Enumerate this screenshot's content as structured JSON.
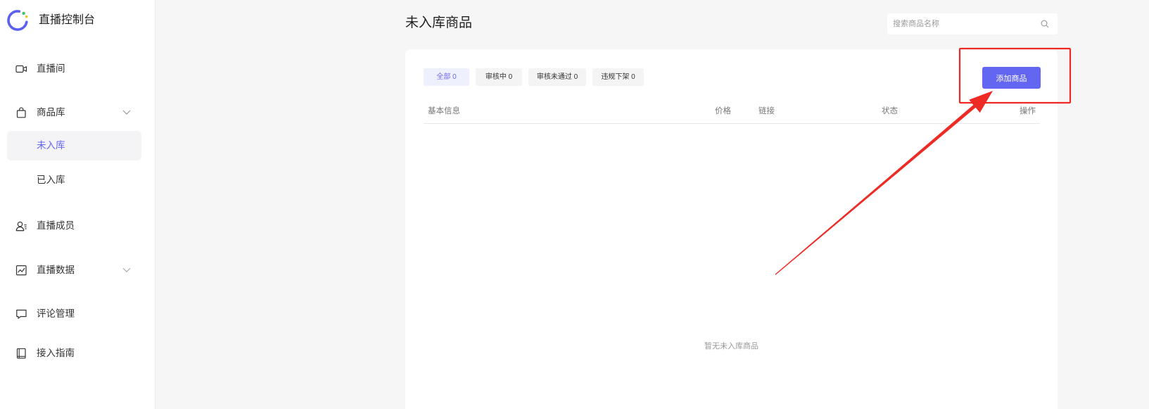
{
  "app": {
    "title": "直播控制台",
    "logo_icon": "app-logo-icon"
  },
  "sidebar": {
    "items": [
      {
        "label": "直播间",
        "icon": "video-camera-icon"
      },
      {
        "label": "商品库",
        "icon": "shopping-bag-icon",
        "expanded": true,
        "children": [
          {
            "label": "未入库",
            "active": true
          },
          {
            "label": "已入库",
            "active": false
          }
        ]
      },
      {
        "label": "直播成员",
        "icon": "user-group-icon"
      },
      {
        "label": "直播数据",
        "icon": "chart-icon",
        "expanded": false
      },
      {
        "label": "评论管理",
        "icon": "comment-icon"
      },
      {
        "label": "接入指南",
        "icon": "book-icon"
      }
    ]
  },
  "page": {
    "title": "未入库商品"
  },
  "search": {
    "placeholder": "搜索商品名称",
    "icon": "search-icon"
  },
  "tabs": [
    {
      "label": "全部 0",
      "active": true
    },
    {
      "label": "审核中 0",
      "active": false
    },
    {
      "label": "审核未通过 0",
      "active": false
    },
    {
      "label": "违规下架 0",
      "active": false
    }
  ],
  "actions": {
    "add_product_label": "添加商品"
  },
  "table": {
    "columns": [
      "基本信息",
      "价格",
      "链接",
      "状态",
      "操作"
    ],
    "rows": [],
    "empty_text": "暂无未入库商品"
  },
  "theme": {
    "accent": "#6366f1",
    "annotation": "#ee2a24"
  }
}
